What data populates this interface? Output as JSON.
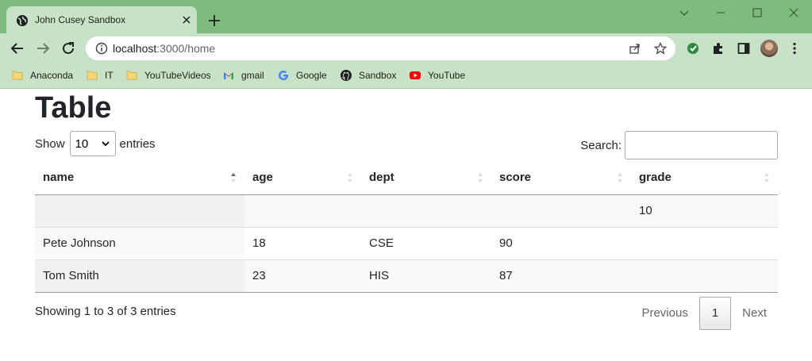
{
  "browser": {
    "tab_title": "John Cusey Sandbox",
    "url_host": "localhost",
    "url_rest": ":3000/home",
    "bookmarks": [
      {
        "label": "Anaconda",
        "icon": "folder-icon"
      },
      {
        "label": "IT",
        "icon": "folder-icon"
      },
      {
        "label": "YouTubeVideos",
        "icon": "folder-icon"
      },
      {
        "label": "gmail",
        "icon": "gmail-icon"
      },
      {
        "label": "Google",
        "icon": "google-icon"
      },
      {
        "label": "Sandbox",
        "icon": "github-icon"
      },
      {
        "label": "YouTube",
        "icon": "youtube-icon"
      }
    ],
    "colors": {
      "frame": "#7ebb7c",
      "toolbar": "#c7e2c6"
    }
  },
  "page": {
    "title": "Table",
    "length": {
      "prefix": "Show",
      "value": "10",
      "suffix": "entries"
    },
    "search": {
      "label": "Search:",
      "value": ""
    },
    "table": {
      "headers": [
        "name",
        "age",
        "dept",
        "score",
        "grade"
      ],
      "sorted_column": "name",
      "rows": [
        [
          "",
          "",
          "",
          "",
          "10"
        ],
        [
          "Pete Johnson",
          "18",
          "CSE",
          "90",
          ""
        ],
        [
          "Tom Smith",
          "23",
          "HIS",
          "87",
          ""
        ]
      ]
    },
    "info": "Showing 1 to 3 of 3 entries",
    "pagination": {
      "previous": "Previous",
      "current": "1",
      "next": "Next"
    }
  }
}
